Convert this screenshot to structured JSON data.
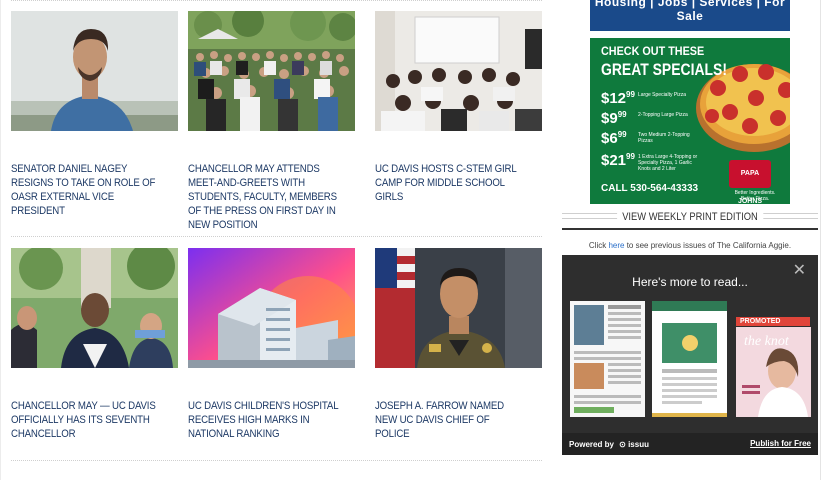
{
  "articles": [
    {
      "headline": "SENATOR DANIEL NAGEY RESIGNS TO TAKE ON ROLE OF OASR EXTERNAL VICE PRESIDENT"
    },
    {
      "headline": "CHANCELLOR MAY ATTENDS MEET-AND-GREETS WITH STUDENTS, FACULTY, MEMBERS OF THE PRESS ON FIRST DAY IN NEW POSITION"
    },
    {
      "headline": "UC DAVIS HOSTS C-STEM GIRL CAMP FOR MIDDLE SCHOOL GIRLS"
    },
    {
      "headline": "CHANCELLOR MAY — UC DAVIS OFFICIALLY HAS ITS SEVENTH CHANCELLOR"
    },
    {
      "headline": "UC DAVIS CHILDREN'S HOSPITAL RECEIVES HIGH MARKS IN NATIONAL RANKING"
    },
    {
      "headline": "JOSEPH A. FARROW NAMED NEW UC DAVIS CHIEF OF POLICE"
    }
  ],
  "sidebar": {
    "top_ad": {
      "text": "Housing | Jobs | Services | For Sale",
      "color": "#1a4a8a"
    },
    "pizza_ad": {
      "heading_line1": "CHECK OUT THESE",
      "heading_line2": "GREAT SPECIALS!",
      "deals": [
        {
          "dollars": "$12",
          "cents": "99",
          "desc": "Large Specialty Pizza"
        },
        {
          "dollars": "$9",
          "cents": "99",
          "desc": "2-Topping Large Pizza"
        },
        {
          "dollars": "$6",
          "cents": "99",
          "desc": "Two Medium 2-Topping Pizzas"
        },
        {
          "dollars": "$21",
          "cents": "99",
          "desc": "1 Extra Large 4-Topping or Specialty Pizza, 1 Garlic Knots and 2 Liter"
        }
      ],
      "call": "CALL 530-564-43333",
      "brand": "PAPA JOHNS",
      "tagline": "Better Ingredients. Better Pizza.",
      "color": "#0f7a3d"
    },
    "print_edition": {
      "title": "VIEW WEEKLY PRINT EDITION",
      "archive_prefix": "Click ",
      "archive_link": "here",
      "archive_suffix": " to see previous issues of The California Aggie."
    },
    "issuu": {
      "title": "Here's more to read...",
      "close": "✕",
      "promoted_label": "PROMOTED",
      "powered_by": "Powered by",
      "brand": "issuu",
      "publish_link": "Publish for Free",
      "mag_title": "the knot"
    }
  }
}
